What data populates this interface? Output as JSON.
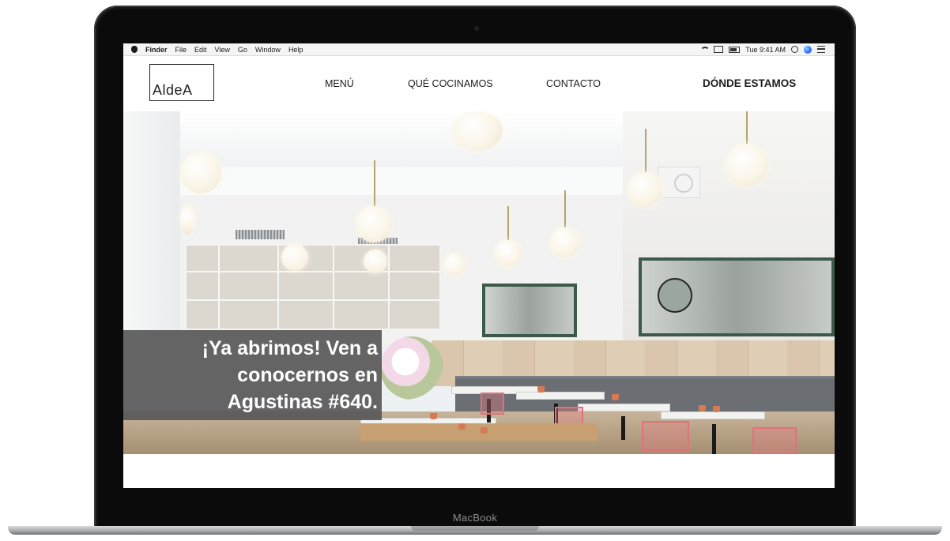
{
  "device": {
    "label": "MacBook"
  },
  "menubar": {
    "apple_icon": "apple-logo-icon",
    "app_name": "Finder",
    "menus": [
      "File",
      "Edit",
      "View",
      "Go",
      "Window",
      "Help"
    ],
    "clock": "Tue 9:41 AM",
    "status_icons": [
      "wifi-icon",
      "airplay-icon",
      "battery-icon",
      "spotlight-search-icon",
      "siri-icon",
      "notification-center-icon"
    ]
  },
  "site": {
    "logo_text": "AldeA",
    "nav": {
      "menu": "MENÚ",
      "que_cocinamos": "QUÉ COCINAMOS",
      "contacto": "CONTACTO",
      "donde_estamos": "DÓNDE ESTAMOS"
    },
    "hero": {
      "headline": "¡Ya abrimos! Ven a\nconocernos en\nAgustinas #640."
    }
  }
}
